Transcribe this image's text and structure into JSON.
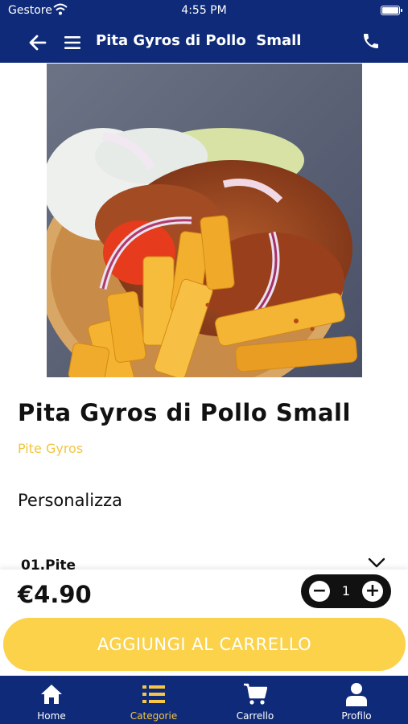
{
  "status_bar": {
    "carrier": "Gestore",
    "time": "4:55 PM"
  },
  "header": {
    "title": "Pita Gyros di Pollo  Small",
    "back_icon": "arrow-left-icon",
    "menu_icon": "hamburger-menu-icon",
    "phone_icon": "phone-icon"
  },
  "product": {
    "title": "Pita Gyros di Pollo Small",
    "category": "Pite Gyros",
    "customize_heading": "Personalizza",
    "option_label": "01.Pite"
  },
  "cart": {
    "price": "€4.90",
    "quantity": "1",
    "add_button_label": "AGGIUNGI AL CARRELLO"
  },
  "tabs": [
    {
      "label": "Home",
      "icon": "home-icon",
      "active": false
    },
    {
      "label": "Categorie",
      "icon": "list-icon",
      "active": true
    },
    {
      "label": "Carrello",
      "icon": "cart-icon",
      "active": false
    },
    {
      "label": "Profilo",
      "icon": "user-icon",
      "active": false
    }
  ],
  "colors": {
    "primary": "#0e2a78",
    "accent": "#fbd24a",
    "category": "#f0c640"
  }
}
